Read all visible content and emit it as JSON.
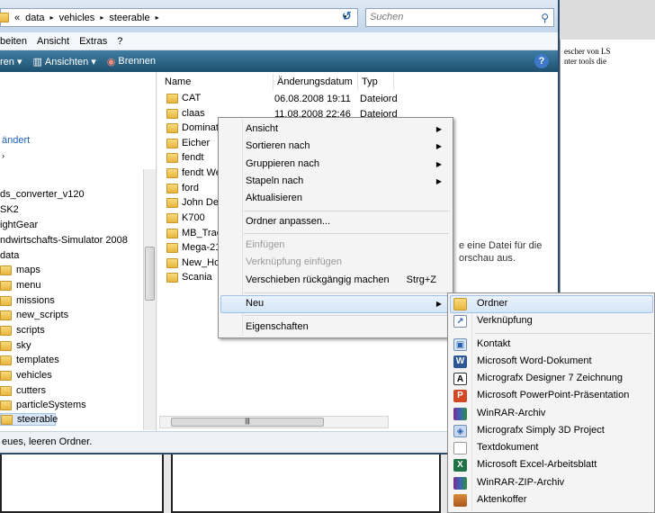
{
  "background_doc": {
    "line1": "escher von LS",
    "line2": "nter tools die"
  },
  "address": {
    "crumbs": [
      "«",
      "data",
      "▸",
      "vehicles",
      "▸",
      "steerable",
      "▸"
    ],
    "search_placeholder": "Suchen"
  },
  "menubar": [
    "beiten",
    "Ansicht",
    "Extras",
    "?"
  ],
  "toolbar": {
    "organize": "ren ▾",
    "views": "Ansichten ▾",
    "burn": "Brennen"
  },
  "nav": {
    "changed": "ändert",
    "items": [
      {
        "label": "ds_converter_v120",
        "folder": false
      },
      {
        "label": "SK2",
        "folder": false
      },
      {
        "label": "ightGear",
        "folder": false
      },
      {
        "label": "ndwirtschafts-Simulator 2008",
        "folder": false
      },
      {
        "label": "data",
        "folder": false
      },
      {
        "label": "maps",
        "folder": true
      },
      {
        "label": "menu",
        "folder": true
      },
      {
        "label": "missions",
        "folder": true
      },
      {
        "label": "new_scripts",
        "folder": true
      },
      {
        "label": "scripts",
        "folder": true
      },
      {
        "label": "sky",
        "folder": true
      },
      {
        "label": "templates",
        "folder": true
      },
      {
        "label": "vehicles",
        "folder": true
      },
      {
        "label": "cutters",
        "folder": true
      },
      {
        "label": "particleSystems",
        "folder": true
      },
      {
        "label": "steerable",
        "folder": true
      }
    ]
  },
  "columns": {
    "name": "Name",
    "date": "Änderungsdatum",
    "type": "Typ"
  },
  "files": [
    {
      "name": "CAT",
      "date": "06.08.2008 19:11",
      "type": "Dateiord"
    },
    {
      "name": "claas",
      "date": "11.08.2008 22:46",
      "type": "Dateiord"
    },
    {
      "name": "Dominat",
      "date": "",
      "type": ""
    },
    {
      "name": "Eicher",
      "date": "",
      "type": ""
    },
    {
      "name": "fendt",
      "date": "",
      "type": ""
    },
    {
      "name": "fendt We",
      "date": "",
      "type": ""
    },
    {
      "name": "ford",
      "date": "",
      "type": ""
    },
    {
      "name": "John Dee",
      "date": "",
      "type": ""
    },
    {
      "name": "K700",
      "date": "",
      "type": ""
    },
    {
      "name": "MB_Trac",
      "date": "",
      "type": ""
    },
    {
      "name": "Mega-21",
      "date": "",
      "type": ""
    },
    {
      "name": "New_Hol",
      "date": "",
      "type": ""
    },
    {
      "name": "Scania",
      "date": "",
      "type": ""
    }
  ],
  "preview": {
    "line1": "e eine Datei für die",
    "line2": "orschau aus."
  },
  "status": "eues, leeren Ordner.",
  "context_menu": {
    "ansicht": "Ansicht",
    "sortieren": "Sortieren nach",
    "gruppieren": "Gruppieren nach",
    "stapeln": "Stapeln nach",
    "aktualisieren": "Aktualisieren",
    "anpassen": "Ordner anpassen...",
    "einfuegen": "Einfügen",
    "verknuepfung_einfuegen": "Verknüpfung einfügen",
    "rueckgaengig": "Verschieben rückgängig machen",
    "rueckgaengig_shortcut": "Strg+Z",
    "neu": "Neu",
    "eigenschaften": "Eigenschaften"
  },
  "submenu": [
    {
      "label": "Ordner",
      "icon": "folder-icon"
    },
    {
      "label": "Verknüpfung",
      "icon": "shortcut-icon"
    },
    {
      "label": "Kontakt",
      "icon": "contact-icon"
    },
    {
      "label": "Microsoft Word-Dokument",
      "icon": "word-icon"
    },
    {
      "label": "Micrografx Designer 7 Zeichnung",
      "icon": "designer-icon"
    },
    {
      "label": "Microsoft PowerPoint-Präsentation",
      "icon": "powerpoint-icon"
    },
    {
      "label": "WinRAR-Archiv",
      "icon": "winrar-icon"
    },
    {
      "label": "Micrografx Simply 3D Project",
      "icon": "simply3d-icon"
    },
    {
      "label": "Textdokument",
      "icon": "text-icon"
    },
    {
      "label": "Microsoft Excel-Arbeitsblatt",
      "icon": "excel-icon"
    },
    {
      "label": "WinRAR-ZIP-Archiv",
      "icon": "winrar-zip-icon"
    },
    {
      "label": "Aktenkoffer",
      "icon": "briefcase-icon"
    }
  ]
}
